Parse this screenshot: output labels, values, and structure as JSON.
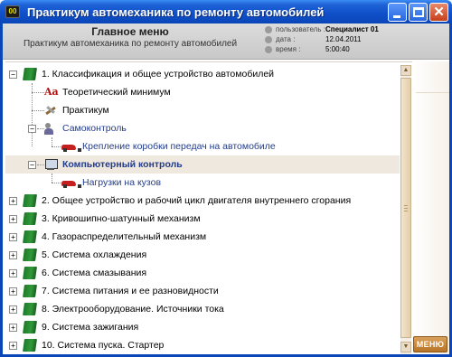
{
  "window": {
    "title": "Практикум автомеханика по ремонту автомобилей",
    "icon_text": "00"
  },
  "header": {
    "title": "Главное меню",
    "subtitle": "Практикум автомеханика по ремонту автомобилей",
    "info": {
      "user_label": "пользователь :",
      "user_value": "Специалист 01",
      "date_label": "дата :",
      "date_value": "12.04.2011",
      "time_label": "время :",
      "time_value": "5:00:40"
    }
  },
  "tree": {
    "items": [
      {
        "label": "1. Классификация и общее устройство автомобилей",
        "icon": "book-icon",
        "expander": "⊟"
      },
      {
        "label": "Теоретический минимум",
        "icon": "text-aa-icon"
      },
      {
        "label": "Практикум",
        "icon": "tools-icon"
      },
      {
        "label": "Самоконтроль",
        "icon": "people-icon",
        "expander": "⊟"
      },
      {
        "label": "Крепление коробки передач на автомобиле",
        "icon": "car-icon"
      },
      {
        "label": "Компьютерный контроль",
        "icon": "computer-icon",
        "expander": "⊟",
        "selected": true
      },
      {
        "label": "Нагрузки на кузов",
        "icon": "car-icon"
      },
      {
        "label": "2. Общее устройство и рабочий цикл двигателя внутреннего сгорания",
        "icon": "book-icon",
        "expander": "⊞"
      },
      {
        "label": "3. Кривошипно-шатунный механизм",
        "icon": "book-icon",
        "expander": "⊞"
      },
      {
        "label": "4. Газораспределительный механизм",
        "icon": "book-icon",
        "expander": "⊞"
      },
      {
        "label": "5. Система охлаждения",
        "icon": "book-icon",
        "expander": "⊞"
      },
      {
        "label": "6. Система смазывания",
        "icon": "book-icon",
        "expander": "⊞"
      },
      {
        "label": "7. Система питания и ее разновидности",
        "icon": "book-icon",
        "expander": "⊞"
      },
      {
        "label": "8. Электрооборудование. Источники тока",
        "icon": "book-icon",
        "expander": "⊞"
      },
      {
        "label": "9. Система зажигания",
        "icon": "book-icon",
        "expander": "⊞"
      },
      {
        "label": "10. Система пуска. Стартер",
        "icon": "book-icon",
        "expander": "⊞"
      }
    ]
  },
  "scrollbar": {
    "up": "▲",
    "down": "▼"
  },
  "menu_button": {
    "label": "МЕНЮ"
  },
  "colors": {
    "title_bar": "#0f4fc8",
    "selection": "#efe8df",
    "link_blue": "#223c8c",
    "menu_button": "#c98a3e"
  }
}
